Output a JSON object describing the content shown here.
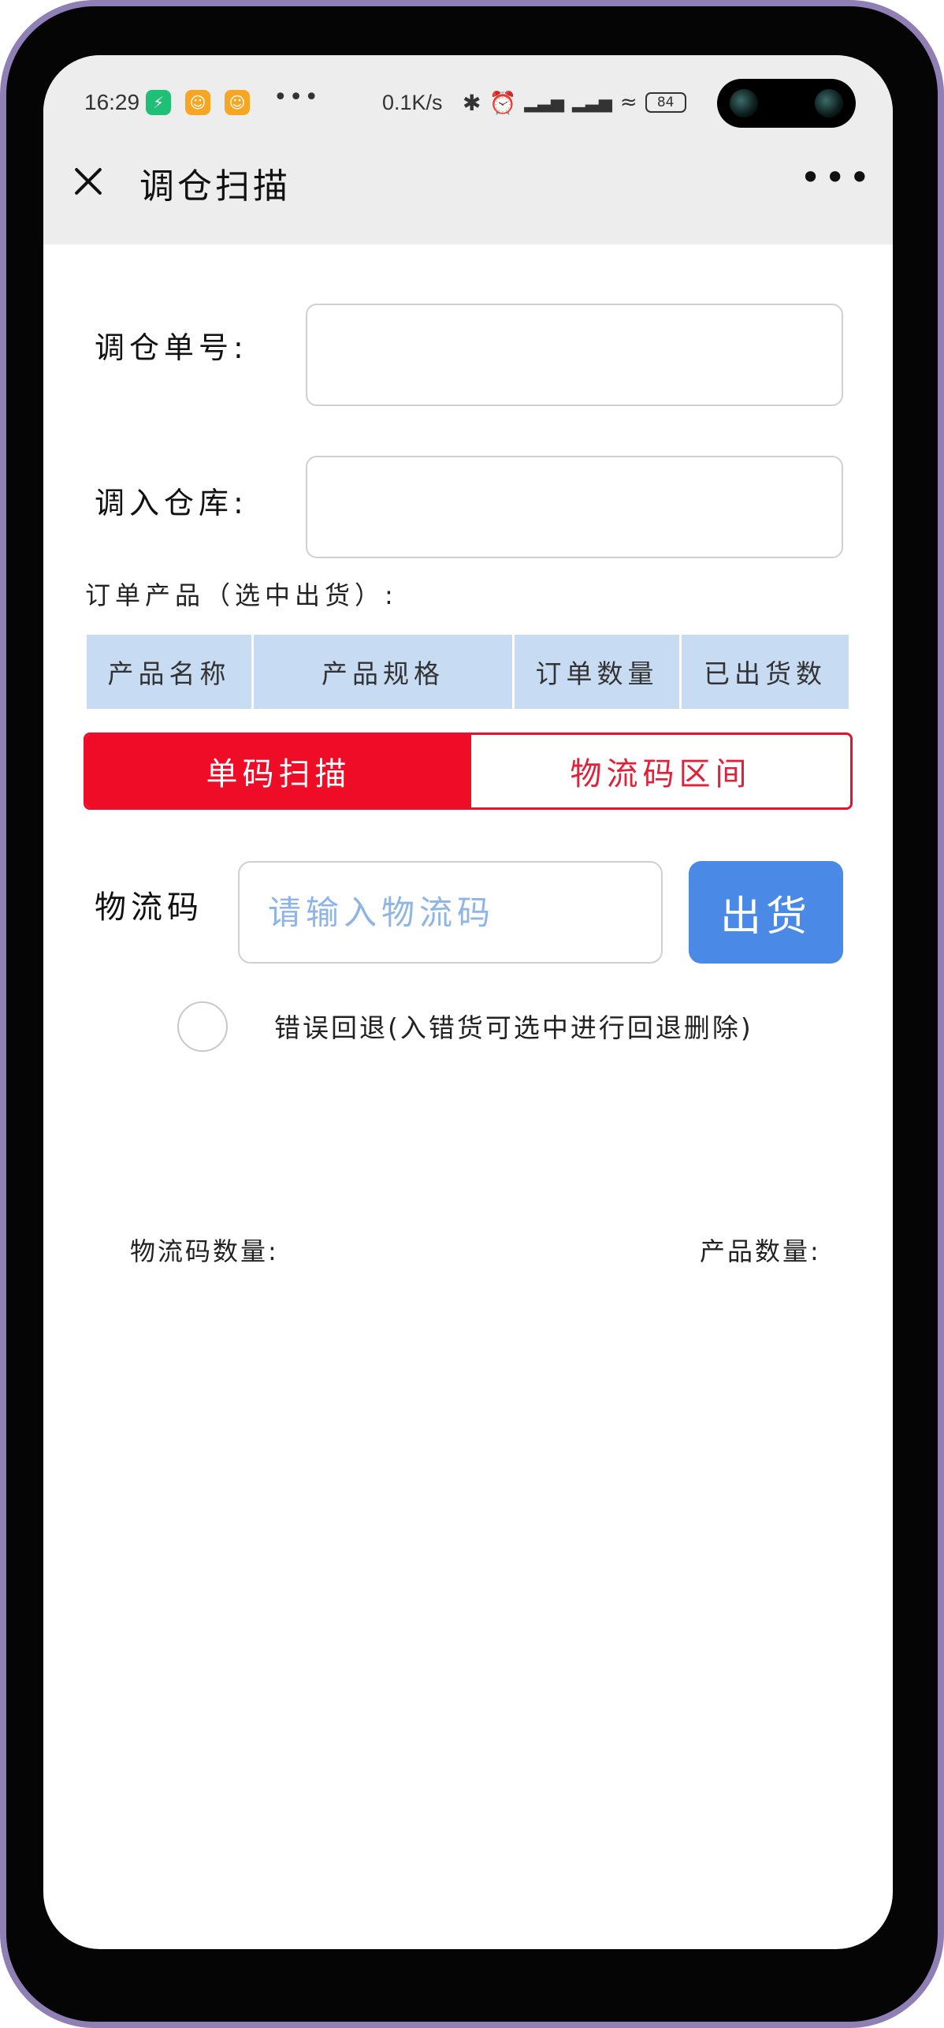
{
  "status_bar": {
    "time": "16:29",
    "network_speed": "0.1K/s",
    "battery": "84",
    "icons": [
      "shield-app-icon",
      "cat-app-icon",
      "cat-app-icon",
      "more-dots-icon",
      "bluetooth-icon",
      "alarm-icon",
      "hd-signal-icon",
      "signal-icon",
      "wifi-icon",
      "battery-icon"
    ]
  },
  "header": {
    "title": "调仓扫描"
  },
  "form": {
    "order_no_label": "调仓单号:",
    "warehouse_label": "调入仓库:",
    "order_products_label": "订单产品（选中出货）:"
  },
  "table": {
    "columns": [
      "产品名称",
      "产品规格",
      "订单数量",
      "已出货数"
    ]
  },
  "scan_mode": {
    "tabs": [
      "单码扫描",
      "物流码区间"
    ],
    "active_index": 0
  },
  "scan": {
    "label": "物流码",
    "placeholder": "请输入物流码",
    "ship_button": "出货"
  },
  "rollback": {
    "label": "错误回退(入错货可选中进行回退删除)"
  },
  "counts": {
    "logistics_count_label": "物流码数量:",
    "product_count_label": "产品数量:"
  },
  "colors": {
    "accent_red": "#ee0c26",
    "button_blue": "#4a89e6",
    "table_header": "#c7dbf3",
    "header_bg": "#ededed"
  }
}
